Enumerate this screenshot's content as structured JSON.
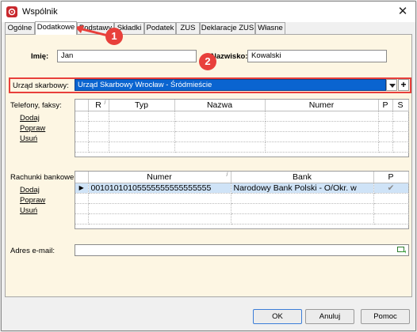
{
  "window": {
    "title": "Wspólnik",
    "close_glyph": "✕"
  },
  "tabs": [
    "Ogólne",
    "Dodatkowe",
    "Podstawy",
    "Składki",
    "Podatek",
    "ZUS",
    "Deklaracje ZUS",
    "Własne"
  ],
  "active_tab": "Dodatkowe",
  "form": {
    "imie_label": "Imię:",
    "imie_value": "Jan",
    "nazwisko_label": "Nazwisko:",
    "nazwisko_value": "Kowalski",
    "urzad_label": "Urząd skarbowy:",
    "urzad_value": "Urząd Skarbowy Wrocław - Śródmieście",
    "plus_glyph": "+"
  },
  "phones": {
    "label": "Telefony, faksy:",
    "actions": [
      "Dodaj",
      "Popraw",
      "Usuń"
    ],
    "columns": [
      "R",
      "Typ",
      "Nazwa",
      "Numer",
      "P",
      "S"
    ]
  },
  "accounts": {
    "label": "Rachunki bankowe:",
    "actions": [
      "Dodaj",
      "Popraw",
      "Usuń"
    ],
    "columns": [
      "Numer",
      "Bank",
      "P"
    ],
    "rows": [
      {
        "marker": "▶",
        "numer": "00101010105555555555555555",
        "bank": "Narodowy Bank Polski  - O/Okr. w",
        "p": "✔"
      }
    ]
  },
  "email": {
    "label": "Adres e-mail:",
    "value": ""
  },
  "buttons": {
    "ok": "OK",
    "cancel": "Anuluj",
    "help": "Pomoc"
  },
  "annotations": [
    "1",
    "2"
  ],
  "colors": {
    "highlight": "#e8403b",
    "selection": "#0a64d0",
    "panel": "#fdf6e3"
  }
}
